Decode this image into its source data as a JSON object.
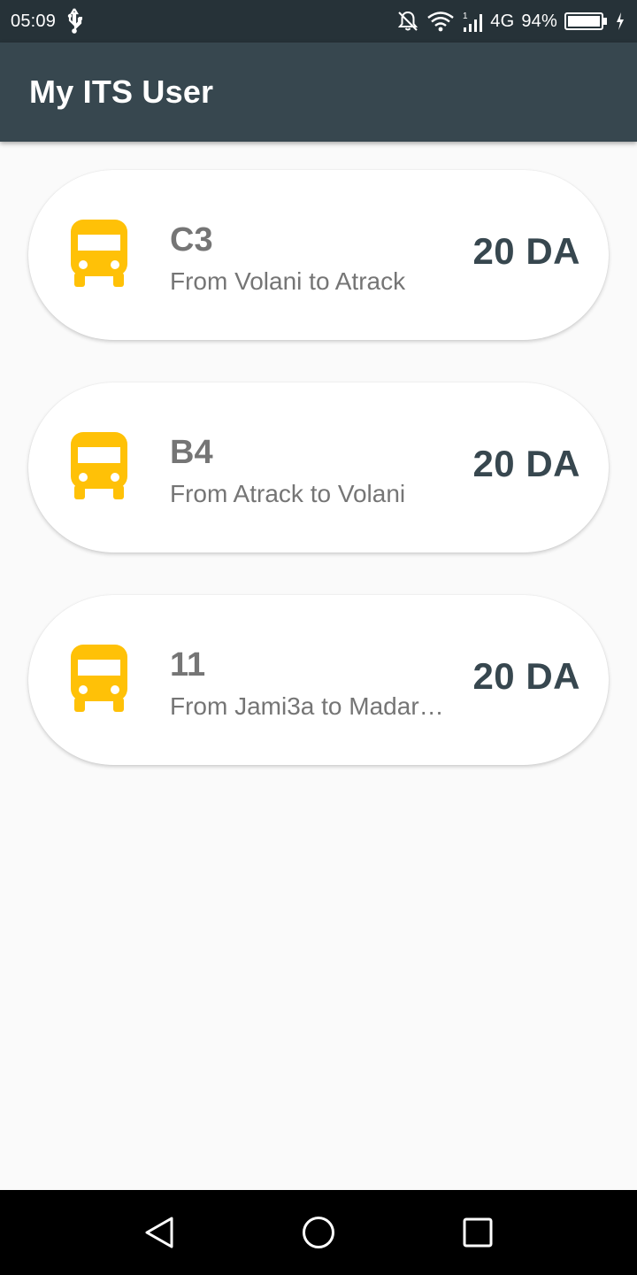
{
  "status_bar": {
    "time": "05:09",
    "network": "4G",
    "signal_sim": "1",
    "battery": "94%",
    "icons": [
      "usb-icon",
      "notifications-off-icon",
      "wifi-icon",
      "signal-icon",
      "battery-icon",
      "charging-icon"
    ]
  },
  "app_bar": {
    "title": "My ITS User"
  },
  "routes": [
    {
      "name": "C3",
      "description": "From Volani to Atrack",
      "price": "20 DA",
      "icon": "bus-icon"
    },
    {
      "name": "B4",
      "description": "From Atrack to Volani",
      "price": "20 DA",
      "icon": "bus-icon"
    },
    {
      "name": "11",
      "description": "From Jami3a to Madar…",
      "price": "20 DA",
      "icon": "bus-icon"
    }
  ],
  "nav_bar": {
    "icons": [
      "back-icon",
      "home-icon",
      "recents-icon"
    ]
  },
  "colors": {
    "status_bar": "#263238",
    "app_bar": "#37474f",
    "background": "#fafafa",
    "card": "#ffffff",
    "bus_icon": "#ffc107",
    "route_text": "#757575",
    "price_text": "#37474f"
  }
}
